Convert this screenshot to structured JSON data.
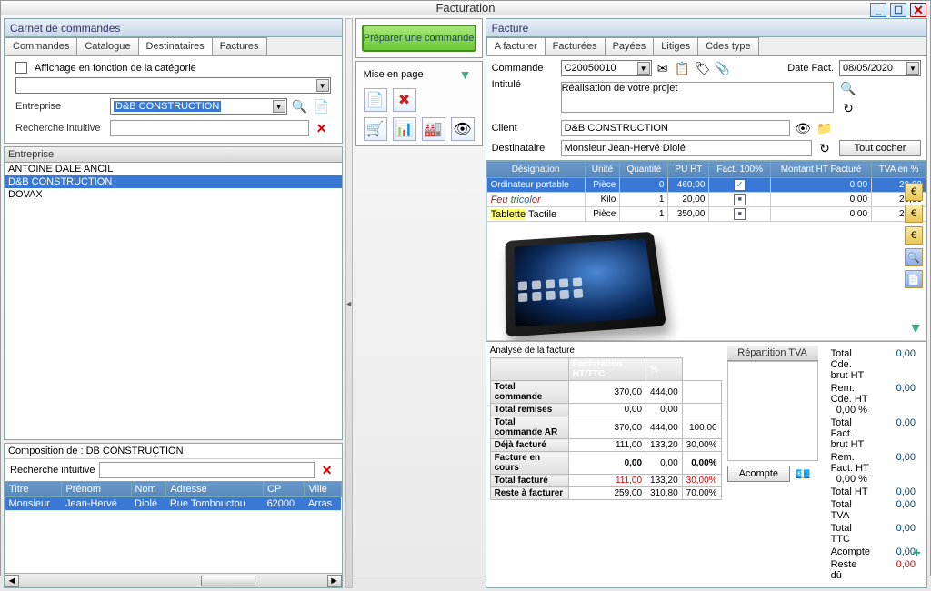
{
  "window": {
    "title": "Facturation"
  },
  "left_panel": {
    "title": "Carnet de commandes",
    "tabs": [
      "Commandes",
      "Catalogue",
      "Destinataires",
      "Factures"
    ],
    "active_tab": 2,
    "affichage_label": "Affichage en fonction de la catégorie",
    "entreprise_label": "Entreprise",
    "entreprise_value": "D&B CONSTRUCTION",
    "recherche_label": "Recherche intuitive",
    "list_header": "Entreprise",
    "entreprises": [
      "ANTOINE DALE ANCIL",
      "D&B CONSTRUCTION",
      "DOVAX"
    ],
    "selected_index": 1,
    "composition_title": "Composition de : DB CONSTRUCTION",
    "composition_recherche": "Recherche intuitive",
    "comp_cols": [
      "Titre",
      "Prénom",
      "Nom",
      "Adresse",
      "CP",
      "Ville"
    ],
    "comp_rows": [
      {
        "titre": "Monsieur",
        "prenom": "Jean-Hervé",
        "nom": "Diolé",
        "adresse": "Rue Tombouctou",
        "cp": "62000",
        "ville": "Arras"
      }
    ]
  },
  "center": {
    "prepare_btn": "Préparer une commande",
    "mise_en_page": "Mise en page"
  },
  "right_panel": {
    "title": "Facture",
    "tabs": [
      "A facturer",
      "Facturées",
      "Payées",
      "Litiges",
      "Cdes type"
    ],
    "active_tab": 0,
    "commande_label": "Commande",
    "commande_value": "C20050010",
    "date_label": "Date Fact.",
    "date_value": "08/05/2020",
    "intitule_label": "Intitulé",
    "intitule_value": "Réalisation de votre projet",
    "client_label": "Client",
    "client_value": "D&B CONSTRUCTION",
    "dest_label": "Destinataire",
    "dest_value": "Monsieur Jean-Hervé Diolé",
    "tout_cocher": "Tout cocher",
    "grid_cols": [
      "Désignation",
      "Unité",
      "Quantité",
      "PU HT",
      "Fact. 100%",
      "Montant HT Facturé",
      "TVA en %"
    ],
    "grid_rows": [
      {
        "des": "Ordinateur portable",
        "unit": "Pièce",
        "qty": "0",
        "pu": "460,00",
        "f100": "checked",
        "mht": "0,00",
        "tva": "20,00",
        "sel": true
      },
      {
        "des_parts": [
          {
            "t": "Feu ",
            "c": "fc1 italic-colored"
          },
          {
            "t": "tri",
            "c": "fc3 italic-colored"
          },
          {
            "t": "col",
            "c": "fc2 italic-colored"
          },
          {
            "t": "or",
            "c": "fc1 italic-colored"
          }
        ],
        "unit": "Kilo",
        "qty": "1",
        "pu": "20,00",
        "f100": "partial",
        "mht": "0,00",
        "tva": "20,00"
      },
      {
        "des_parts": [
          {
            "t": "Tablette",
            "c": "highlight-yellow"
          },
          {
            "t": " Tactile",
            "c": ""
          }
        ],
        "unit": "Pièce",
        "qty": "1",
        "pu": "350,00",
        "f100": "partial",
        "mht": "0,00",
        "tva": "20,00",
        "has_image": true
      }
    ],
    "analyse_title": "Analyse de la facture",
    "analyse_header": [
      "Facturation HT/TTC",
      "%"
    ],
    "analyse_rows": [
      {
        "l": "Total commande",
        "ht": "370,00",
        "ttc": "444,00",
        "pc": ""
      },
      {
        "l": "Total remises",
        "ht": "0,00",
        "ttc": "0,00",
        "pc": ""
      },
      {
        "l": "Total commande AR",
        "ht": "370,00",
        "ttc": "444,00",
        "pc": "100,00"
      },
      {
        "l": "Déjà facturé",
        "ht": "111,00",
        "ttc": "133,20",
        "pc": "30,00%"
      },
      {
        "l": "Facture en cours",
        "ht": "0,00",
        "ttc": "0,00",
        "pc": "0,00%",
        "bold": true
      },
      {
        "l": "Total facturé",
        "ht": "111,00",
        "ttc": "133,20",
        "pc": "30,00%",
        "red": true
      },
      {
        "l": "Reste à facturer",
        "ht": "259,00",
        "ttc": "310,80",
        "pc": "70,00%"
      }
    ],
    "repartition_label": "Répartition TVA",
    "acompte_btn": "Acompte",
    "totals": [
      {
        "l": "Total Cde. brut HT",
        "v": "0,00"
      },
      {
        "l": "Rem. Cde. HT",
        "p": "0,00 %",
        "v": "0,00"
      },
      {
        "l": "Total Fact. brut HT",
        "v": "0,00"
      },
      {
        "l": "Rem. Fact. HT",
        "p": "0,00 %",
        "v": "0,00"
      },
      {
        "l": "Total HT",
        "v": "0,00"
      },
      {
        "l": "Total TVA",
        "v": "0,00"
      },
      {
        "l": "Total TTC",
        "v": "0,00"
      }
    ],
    "acompte_label": "Acompte",
    "acompte_val": "0,00",
    "reste_label": "Reste dû",
    "reste_val": "0,00"
  }
}
